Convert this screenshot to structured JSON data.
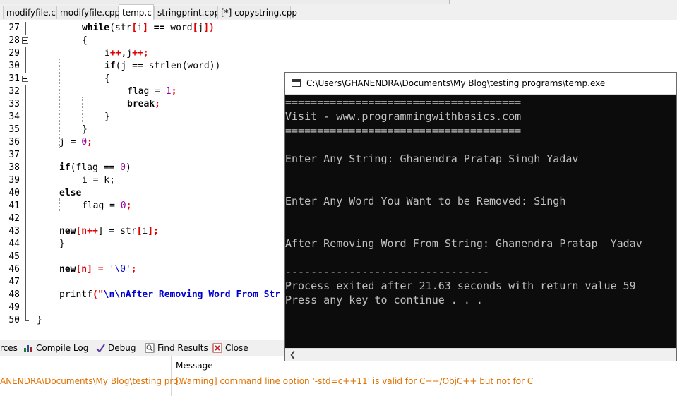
{
  "file_tabs": [
    {
      "label": "modifyfile.c",
      "active": false
    },
    {
      "label": "modifyfile.cpp",
      "active": false
    },
    {
      "label": "temp.c",
      "active": true
    },
    {
      "label": "stringprint.cpp",
      "active": false
    },
    {
      "label": "[*] copystring.cpp",
      "active": false
    }
  ],
  "line_numbers": [
    "27",
    "28",
    "29",
    "30",
    "31",
    "32",
    "33",
    "34",
    "35",
    "36",
    "37",
    "38",
    "39",
    "40",
    "41",
    "42",
    "43",
    "44",
    "45",
    "46",
    "47",
    "48",
    "49",
    "50"
  ],
  "code": {
    "l27": {
      "kw": "while",
      "a": "(str",
      "b": "[",
      "c": "i",
      "d": "]",
      "e": " == ",
      "f": "word",
      "g": "[",
      "h": "j",
      "i": "])"
    },
    "l28": {
      "a": "{"
    },
    "l29": {
      "a": "i",
      "b": "++",
      "c": ",j",
      "d": "++",
      "e": ";"
    },
    "l30": {
      "kw": "if",
      "a": "(j == strlen(word))"
    },
    "l31": {
      "a": "{"
    },
    "l32": {
      "a": "flag = ",
      "b": "1",
      "c": ";"
    },
    "l33": {
      "kw": "break",
      "c": ";"
    },
    "l34": {
      "a": "}"
    },
    "l35": {
      "a": "}"
    },
    "l36": {
      "a": "j = ",
      "b": "0",
      "c": ";"
    },
    "l38": {
      "kw": "if",
      "a": "(flag == ",
      "b": "0",
      "c": ")"
    },
    "l39": {
      "a": "i = k;"
    },
    "l40": {
      "kw": "else"
    },
    "l41": {
      "a": "flag = ",
      "b": "0",
      "c": ";"
    },
    "l43": {
      "kw": "new",
      "a": "[n",
      "b": "++",
      "c": "] = str",
      "d": "[",
      "e": "i",
      "f": "];"
    },
    "l44": {
      "a": "}"
    },
    "l46": {
      "kw": "new",
      "a": "[n] = ",
      "b": "'\\0'",
      "c": ";"
    },
    "l48": {
      "a": "printf",
      "b": "(\"",
      "c": "\\n\\nAfter Removing Word From Str"
    },
    "l50": {
      "a": "}"
    }
  },
  "bottom_tabs": [
    {
      "label": "rces",
      "icon": "resources-icon"
    },
    {
      "label": "Compile Log",
      "icon": "bar-chart-icon"
    },
    {
      "label": "Debug",
      "icon": "check-icon"
    },
    {
      "label": "Find Results",
      "icon": "find-icon"
    },
    {
      "label": "Close",
      "icon": "close-icon"
    }
  ],
  "messages": {
    "column_header": "Message",
    "file": "ANENDRA\\Documents\\My Blog\\testing pro...",
    "message": "[Warning] command line option '-std=c++11' is valid for C++/ObjC++ but not for C"
  },
  "console": {
    "title": "C:\\Users\\GHANENDRA\\Documents\\My Blog\\testing programs\\temp.exe",
    "lines": [
      "=====================================",
      "Visit - www.programmingwithbasics.com",
      "=====================================",
      "",
      "Enter Any String: Ghanendra Pratap Singh Yadav",
      "",
      "",
      "Enter Any Word You Want to be Removed: Singh",
      "",
      "",
      "After Removing Word From String: Ghanendra Pratap  Yadav",
      "",
      "--------------------------------",
      "Process exited after 21.63 seconds with return value 59",
      "Press any key to continue . . ."
    ]
  },
  "colors": {
    "keyword_red": "#e00000",
    "warning_orange": "#e07000",
    "console_bg": "#0c0c0c",
    "console_text": "#c0c0c0"
  }
}
